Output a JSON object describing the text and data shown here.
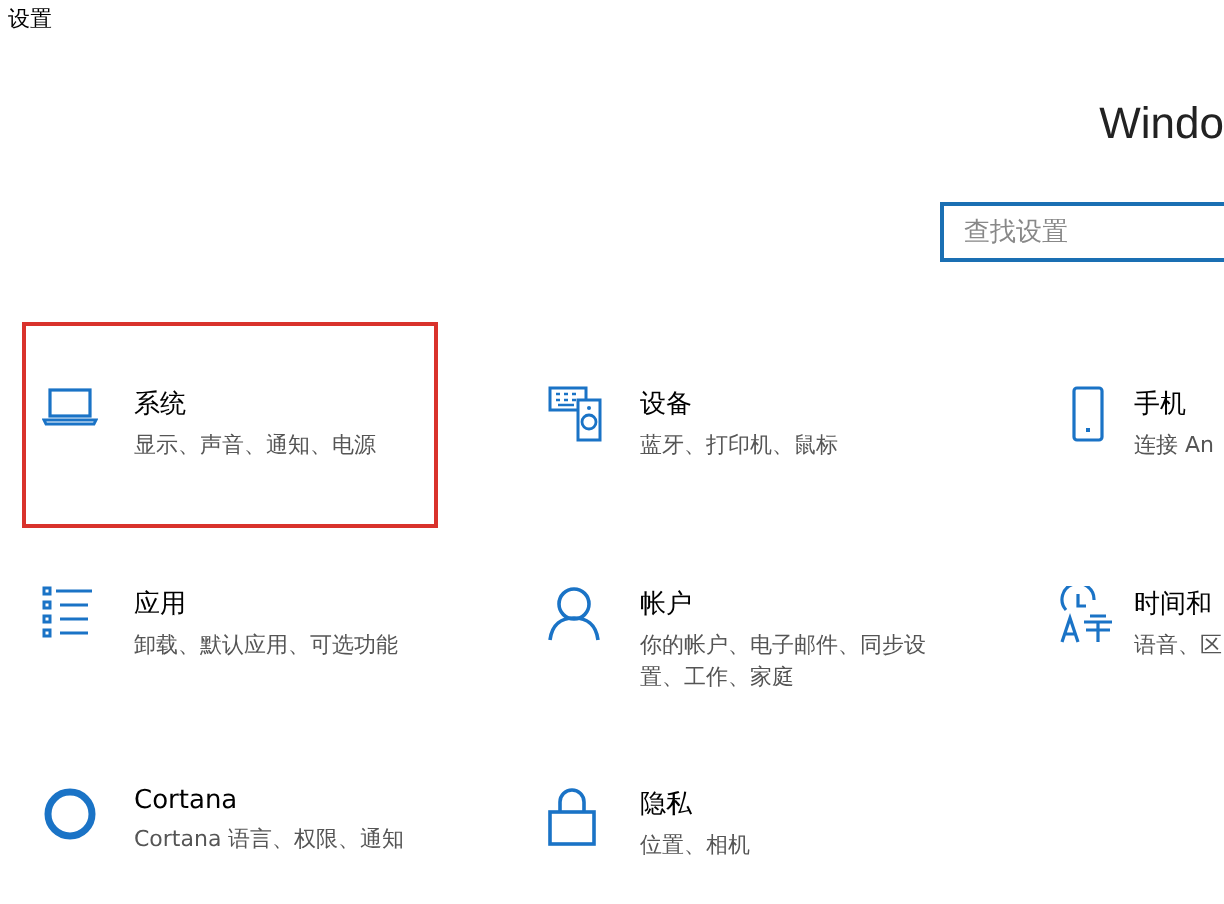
{
  "window": {
    "title": "设置"
  },
  "header": {
    "title": "Windo"
  },
  "search": {
    "placeholder": "查找设置"
  },
  "categories": [
    {
      "name": "系统",
      "description": "显示、声音、通知、电源",
      "highlighted": true
    },
    {
      "name": "设备",
      "description": "蓝牙、打印机、鼠标",
      "highlighted": false
    },
    {
      "name": "手机",
      "description": "连接 An",
      "highlighted": false
    },
    {
      "name": "应用",
      "description": "卸载、默认应用、可选功能",
      "highlighted": false
    },
    {
      "name": "帐户",
      "description": "你的帐户、电子邮件、同步设置、工作、家庭",
      "highlighted": false
    },
    {
      "name": "时间和",
      "description": "语音、区",
      "highlighted": false
    },
    {
      "name": "Cortana",
      "description": "Cortana 语言、权限、通知",
      "highlighted": false
    },
    {
      "name": "隐私",
      "description": "位置、相机",
      "highlighted": false
    }
  ]
}
